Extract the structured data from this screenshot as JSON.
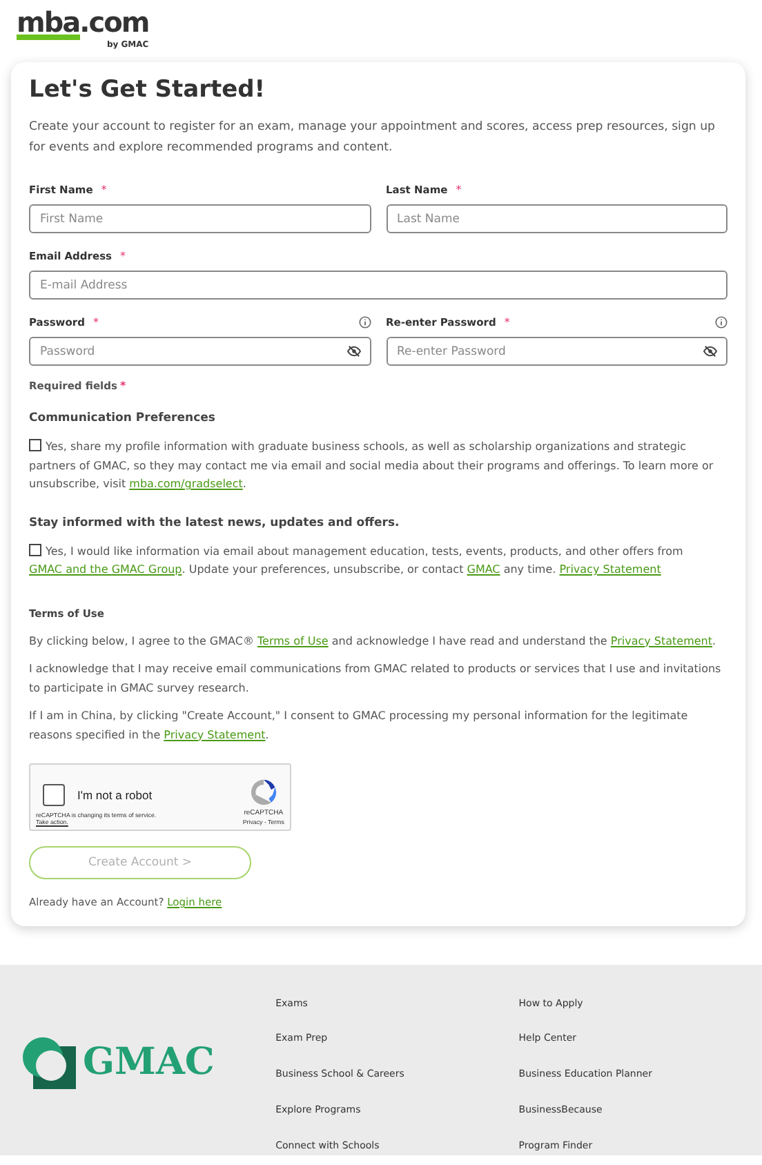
{
  "header": {
    "logo": {
      "name": "mba",
      "tld": ".com",
      "byline": "by GMAC"
    }
  },
  "form": {
    "title": "Let's Get Started!",
    "intro": "Create your account to register for an exam, manage your appointment and scores, access prep resources, sign up for events and explore recommended programs and content.",
    "field_rows": [
      [
        {
          "label": "First Name",
          "required": true,
          "placeholder": "First Name",
          "kind": "text"
        },
        {
          "label": "Last Name",
          "required": true,
          "placeholder": "Last Name",
          "kind": "text"
        }
      ],
      [
        {
          "label": "Email Address",
          "required": true,
          "placeholder": "E-mail Address",
          "kind": "text"
        }
      ],
      [
        {
          "label": "Password",
          "required": true,
          "placeholder": "Password",
          "kind": "password"
        },
        {
          "label": "Re-enter Password",
          "required": true,
          "placeholder": "Re-enter Password",
          "kind": "password"
        }
      ]
    ],
    "required_mark": "*",
    "required_note": "Required fields",
    "sections": [
      {
        "heading": "Communication Preferences",
        "checked": false,
        "segments": [
          {
            "text": "Yes, share my profile information with graduate business schools, as well as scholarship organizations and strategic partners of GMAC, so they may contact me via email and social media about their programs and offerings. To learn more or unsubscribe, visit "
          },
          {
            "link": "mba.com/gradselect"
          },
          {
            "text": "."
          }
        ]
      },
      {
        "heading": "Stay informed with the latest news, updates and offers.",
        "checked": false,
        "segments": [
          {
            "text": "Yes, I would like information via email about management education, tests, events, products, and other offers from "
          },
          {
            "link": "GMAC and the GMAC Group"
          },
          {
            "text": ". Update your preferences, unsubscribe, or contact "
          },
          {
            "link": "GMAC"
          },
          {
            "text": " any time. "
          },
          {
            "link": "Privacy Statement"
          }
        ]
      }
    ],
    "terms_heading": "Terms of Use",
    "terms": [
      [
        {
          "text": "By clicking below, I agree to the GMAC® "
        },
        {
          "link": "Terms of Use"
        },
        {
          "text": " and acknowledge I have read and understand the "
        },
        {
          "link": "Privacy Statement"
        },
        {
          "text": "."
        }
      ],
      [
        {
          "text": "I acknowledge that I may receive email communications from GMAC related to products or services that I use and invitations to participate in GMAC survey research."
        }
      ],
      [
        {
          "text": "If I am in China, by clicking \"Create Account,\" I consent to GMAC processing my personal information for the legitimate reasons specified in the "
        },
        {
          "link": "Privacy Statement"
        },
        {
          "text": "."
        }
      ]
    ],
    "captcha": {
      "checked": false,
      "label": "I'm not a robot",
      "notice": "reCAPTCHA is changing its terms of service.",
      "action": "Take action.",
      "brand": "reCAPTCHA",
      "links": "Privacy - Terms"
    },
    "submit": {
      "label": "Create Account >",
      "disabled": true
    },
    "login": {
      "text": "Already have an Account?",
      "link": "Login here"
    }
  },
  "footer": {
    "logo": "GMAC",
    "columns": [
      [
        "Exams",
        "Exam Prep",
        "Business School & Careers",
        "Explore Programs",
        "Connect with Schools"
      ],
      [
        "How to Apply",
        "Help Center",
        "Business Education Planner",
        "BusinessBecause",
        "Program Finder"
      ]
    ]
  }
}
